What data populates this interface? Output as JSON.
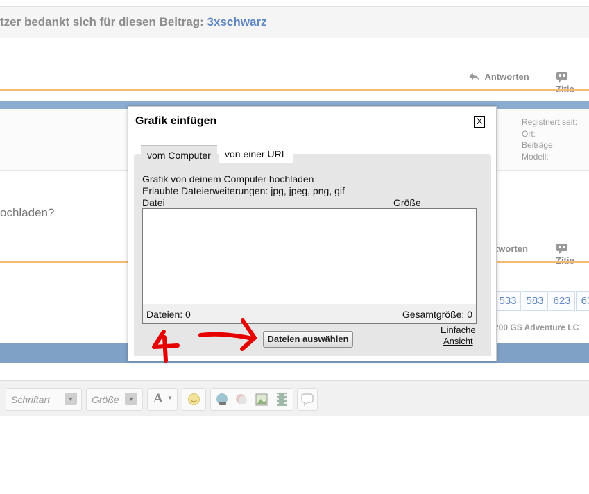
{
  "thanks": {
    "prefix": "tzer bedankt sich für diesen Beitrag:",
    "user": "3xschwarz"
  },
  "post1_actions": {
    "reply": "Antworten",
    "quote": "Zitie"
  },
  "user_info": {
    "registered": "Registriert seit:",
    "location": "Ort:",
    "posts": "Beiträge:",
    "model": "Modell:"
  },
  "post2": {
    "question": "ochladen?"
  },
  "post2_actions": {
    "reply": "ntworten",
    "quote": "Zitie"
  },
  "pagination": [
    "533",
    "583",
    "623",
    "63"
  ],
  "thread_title": "200 GS Adventure LC",
  "editor_toolbar": {
    "font_placeholder": "Schriftart",
    "size_placeholder": "Größe",
    "font_color": "A"
  },
  "modal": {
    "title": "Grafik einfügen",
    "close_label": "X",
    "tabs": [
      {
        "label": "vom Computer",
        "active": true
      },
      {
        "label": "von einer URL",
        "active": false
      }
    ],
    "upload_heading": "Grafik von deinem Computer hochladen",
    "allowed_extensions": "Erlaubte Dateierweiterungen: jpg, jpeg, png, gif",
    "col_file": "Datei",
    "col_size": "Größe",
    "files_count": "Dateien: 0",
    "total_size": "Gesamtgröße: 0",
    "select_button": "Dateien auswählen",
    "simple_view_line1": "Einfache",
    "simple_view_line2": "Ansicht"
  },
  "annotation": {
    "number": "4",
    "color": "#e60000"
  },
  "colors": {
    "link_blue": "#5e86c3",
    "accent_orange": "#f5bb74",
    "header_blue": "#8aaccf"
  }
}
